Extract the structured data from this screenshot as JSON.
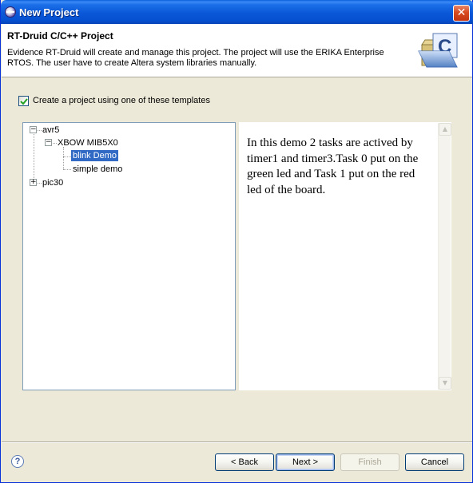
{
  "window": {
    "title": "New Project",
    "close_glyph": "✕"
  },
  "banner": {
    "title": "RT-Druid C/C++ Project",
    "description": "Evidence RT-Druid will create and manage this project. The project will use the ERIKA Enterprise RTOS. The user have to create Altera system libraries manually.",
    "icon": "folder-c-icon"
  },
  "template_checkbox": {
    "label": "Create a project using one of these templates",
    "checked": true
  },
  "tree": {
    "nodes": [
      {
        "label": "avr5",
        "level": 0,
        "expanded": true
      },
      {
        "label": "XBOW MIB5X0",
        "level": 1,
        "expanded": true
      },
      {
        "label": "blink Demo",
        "level": 2,
        "selected": true
      },
      {
        "label": "simple demo",
        "level": 2
      },
      {
        "label": "pic30",
        "level": 0,
        "expanded": false
      }
    ]
  },
  "description_panel": {
    "text": "In this demo 2 tasks are actived by timer1 and timer3.Task 0 put on the green led and Task 1 put on the red led of the board."
  },
  "buttons": {
    "help": "?",
    "back": "< Back",
    "next": "Next >",
    "finish": "Finish",
    "cancel": "Cancel"
  },
  "colors": {
    "selection": "#316ac5",
    "titlebar": "#0a58d8",
    "dialog_bg": "#ece9d8"
  }
}
